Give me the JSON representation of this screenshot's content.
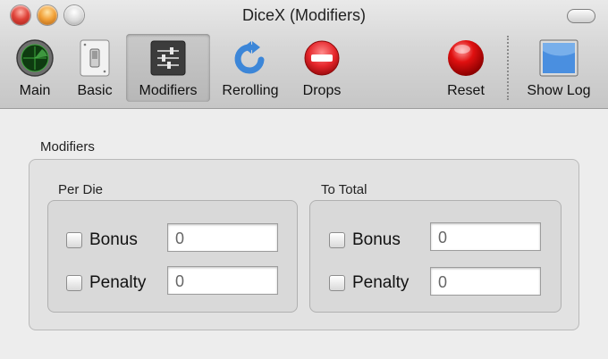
{
  "window": {
    "title": "DiceX (Modifiers)"
  },
  "toolbar": {
    "items": [
      {
        "label": "Main",
        "icon": "main-radar-icon"
      },
      {
        "label": "Basic",
        "icon": "toggle-switch-icon"
      },
      {
        "label": "Modifiers",
        "icon": "sliders-icon",
        "selected": true
      },
      {
        "label": "Rerolling",
        "icon": "reroll-arrow-icon"
      },
      {
        "label": "Drops",
        "icon": "minus-stop-icon"
      },
      {
        "label": "Reset",
        "icon": "red-ball-icon"
      },
      {
        "label": "Show Log",
        "icon": "log-window-icon"
      }
    ]
  },
  "modifiers": {
    "group_label": "Modifiers",
    "per_die": {
      "label": "Per Die",
      "bonus_label": "Bonus",
      "bonus_value": "0",
      "penalty_label": "Penalty",
      "penalty_value": "0"
    },
    "to_total": {
      "label": "To Total",
      "bonus_label": "Bonus",
      "bonus_value": "0",
      "penalty_label": "Penalty",
      "penalty_value": "0"
    }
  },
  "colors": {
    "reset_red": "#e01010",
    "drops_red": "#e5262b",
    "reroll_blue": "#3c86d8",
    "log_blue": "#4a8fe0"
  }
}
